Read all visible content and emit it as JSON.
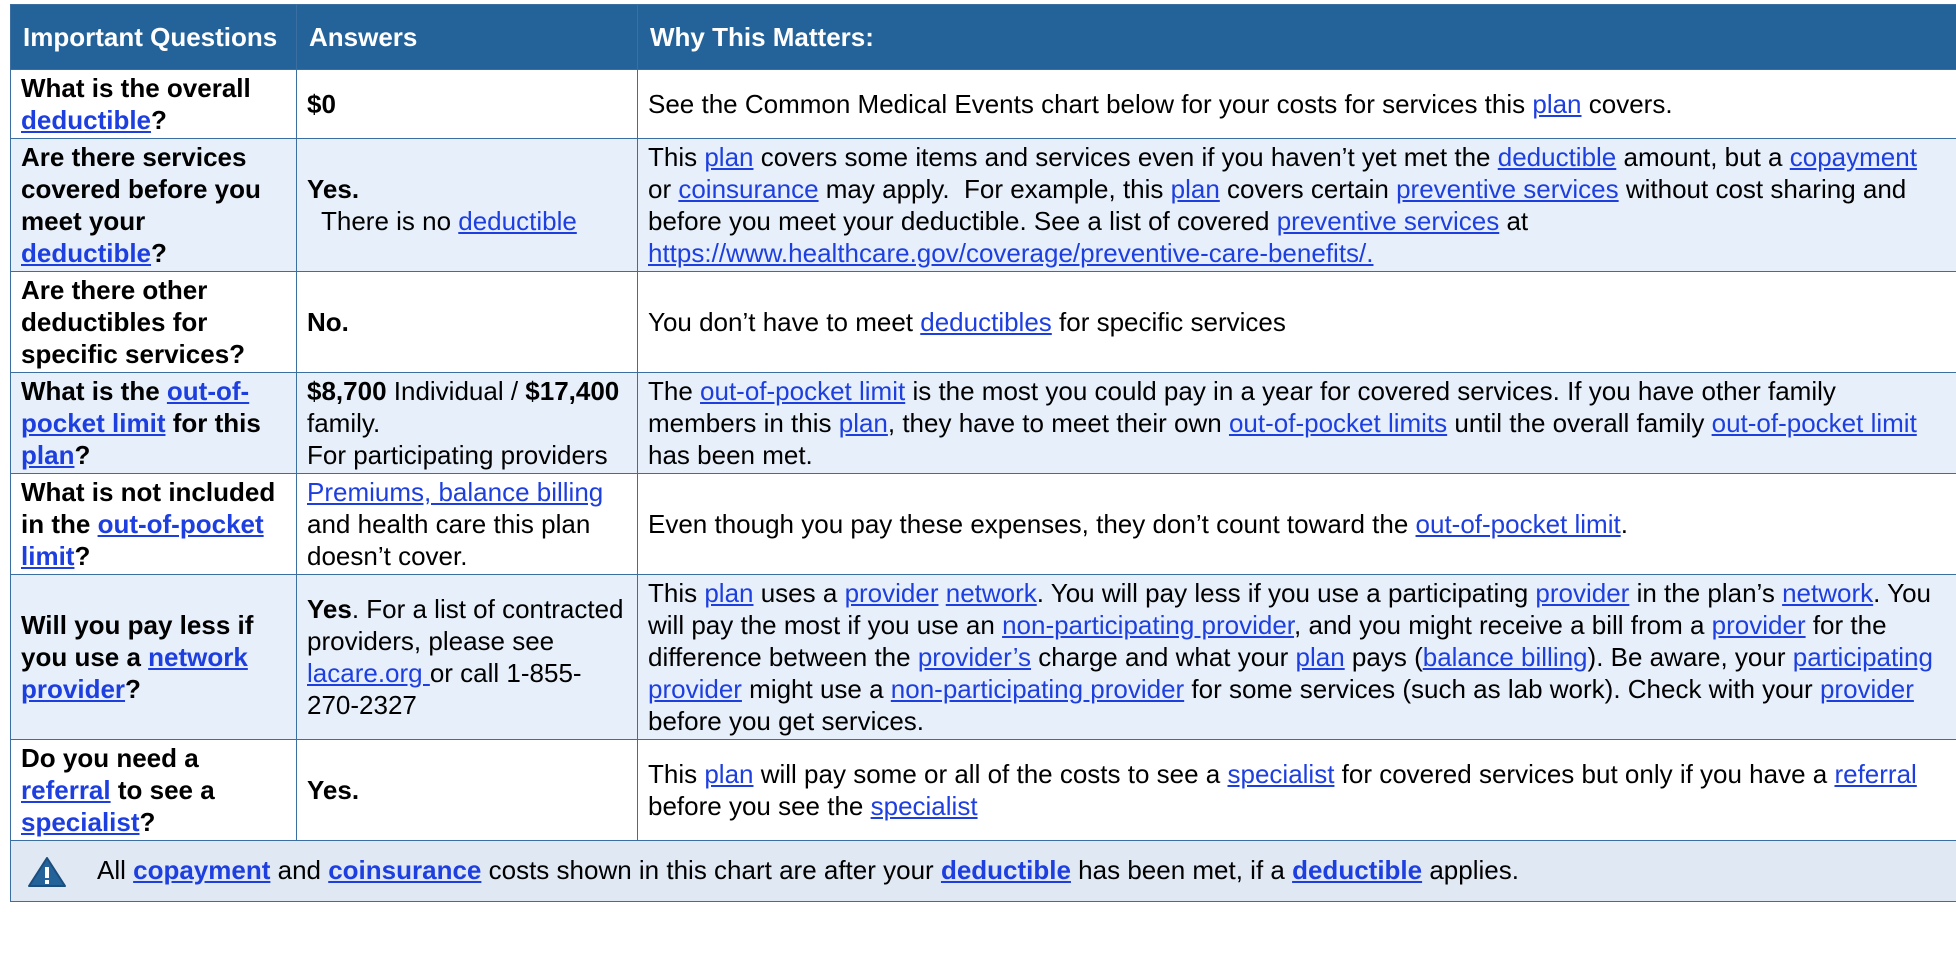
{
  "header": {
    "col_questions": "Important Questions",
    "col_answers": "Answers",
    "col_why": "Why This Matters:"
  },
  "rows": [
    {
      "q": [
        "What is the overall ",
        "deductible",
        "?"
      ],
      "a": [
        "$0"
      ],
      "w": [
        "See the Common Medical Events chart below for your costs for services this ",
        "plan",
        " covers."
      ]
    },
    {
      "q": [
        "Are there services covered before you meet your ",
        "deductible",
        "?"
      ],
      "a": [
        "Yes.",
        "  There is no ",
        "deductible"
      ],
      "w": [
        "This ",
        "plan",
        " covers some items and services even if you haven’t yet met the ",
        "deductible",
        " amount, but a ",
        "copayment",
        " or ",
        "coinsurance",
        " may apply.  For example, this ",
        "plan",
        " covers certain ",
        "preventive services",
        " without cost sharing and before you meet your deductible. See a list of covered ",
        "preventive services",
        " at ",
        "https://www.healthcare.gov/coverage/preventive-care-benefits/."
      ]
    },
    {
      "q": [
        "Are there other deductibles  for specific services?"
      ],
      "a": [
        "No."
      ],
      "w": [
        "You don’t have to meet ",
        "deductibles",
        " for specific services"
      ]
    },
    {
      "q": [
        "What is the ",
        "out-of-pocket limit",
        " for this ",
        "plan",
        "?"
      ],
      "a": [
        "$8,700",
        " Individual / ",
        "$17,400",
        " family.",
        "For participating providers"
      ],
      "w": [
        "The ",
        "out-of-pocket limit",
        " is the most you could pay in a year for covered services. If you have other family members in this ",
        "plan",
        ", they have to meet their own ",
        "out-of-pocket limits",
        " until the overall family ",
        "out-of-pocket limit",
        " has been met."
      ]
    },
    {
      "q": [
        "What is not included in the ",
        "out-of-pocket limit",
        "?"
      ],
      "a": [
        "Premiums, balance billing",
        " and health care this plan doesn’t cover."
      ],
      "w": [
        "Even though you pay these expenses, they don’t count toward the ",
        "out-of-pocket limit",
        "."
      ]
    },
    {
      "q": [
        "Will you pay less if you use a ",
        "network provider",
        "?"
      ],
      "a": [
        "Yes",
        ". For a list of contracted providers, please see ",
        "lacare.org ",
        " or call 1-855-270-2327"
      ],
      "w": [
        "This ",
        "plan",
        " uses a ",
        "provider",
        " ",
        "network",
        ". You will pay less if you use a participating ",
        "provider",
        " in the plan’s ",
        "network",
        ". You will pay the most if you use an ",
        "non-participating provider",
        ", and you might receive a bill from a ",
        "provider",
        " for the difference between the ",
        "provider’s",
        " charge and what your ",
        "plan",
        " pays (",
        "balance billing",
        "). Be aware, your ",
        "participating provider",
        " might use a ",
        "non-participating provider",
        " for some services (such as lab work). Check with your ",
        "provider",
        " before you get services."
      ]
    },
    {
      "q": [
        "Do you need a ",
        "referral",
        " to see a ",
        "specialist",
        "?"
      ],
      "a": [
        "Yes."
      ],
      "w": [
        "This ",
        "plan",
        " will pay some or all of the costs to see a ",
        "specialist",
        " for covered services but only if you have a ",
        "referral",
        " before you see the ",
        "specialist"
      ]
    }
  ],
  "footer": [
    "All ",
    "copayment",
    " and ",
    "coinsurance",
    " costs shown in this chart are after your ",
    "deductible",
    " has been met, if a ",
    "deductible",
    " applies."
  ],
  "icons": {
    "footer": "warning-icon"
  },
  "colors": {
    "header_bg": "#24639a",
    "row_shade": "#e7f0fa",
    "link": "#1e3fe0",
    "footer_bg": "#dfe8f3"
  }
}
